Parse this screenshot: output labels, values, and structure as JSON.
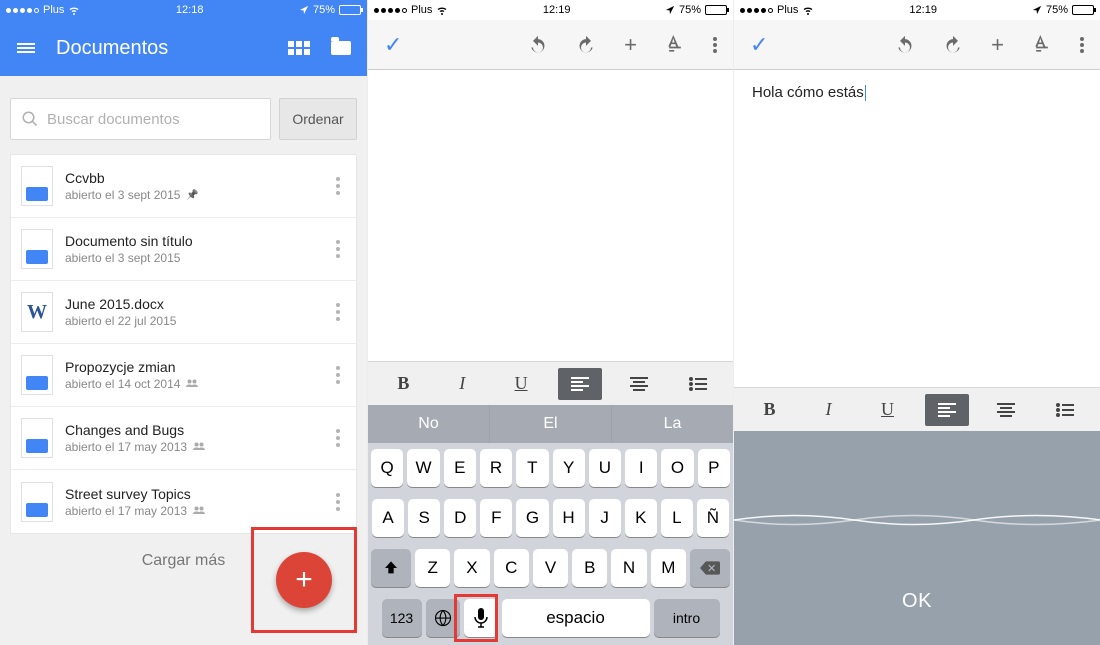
{
  "status": {
    "carrier": "Plus",
    "time1": "12:18",
    "time2": "12:19",
    "time3": "12:19",
    "battery_pct": "75%"
  },
  "screen1": {
    "title": "Documentos",
    "search_placeholder": "Buscar documentos",
    "sort_label": "Ordenar",
    "load_more": "Cargar más",
    "docs": [
      {
        "title": "Ccvbb",
        "subtitle": "abierto el 3 sept 2015",
        "pinned": true,
        "shared": false,
        "type": "gdoc"
      },
      {
        "title": "Documento sin título",
        "subtitle": "abierto el 3 sept 2015",
        "pinned": false,
        "shared": false,
        "type": "gdoc"
      },
      {
        "title": "June 2015.docx",
        "subtitle": "abierto el 22 jul 2015",
        "pinned": false,
        "shared": false,
        "type": "word"
      },
      {
        "title": "Propozycje zmian",
        "subtitle": "abierto el 14 oct 2014",
        "pinned": false,
        "shared": true,
        "type": "gdoc"
      },
      {
        "title": "Changes and Bugs",
        "subtitle": "abierto el 17 may 2013",
        "pinned": false,
        "shared": true,
        "type": "gdoc"
      },
      {
        "title": "Street survey Topics",
        "subtitle": "abierto el 17 may 2013",
        "pinned": false,
        "shared": true,
        "type": "gdoc"
      }
    ]
  },
  "screen3": {
    "doc_text": "Hola cómo estás",
    "ok_label": "OK"
  },
  "keyboard": {
    "suggestions": [
      "No",
      "El",
      "La"
    ],
    "row1": [
      "Q",
      "W",
      "E",
      "R",
      "T",
      "Y",
      "U",
      "I",
      "O",
      "P"
    ],
    "row2": [
      "A",
      "S",
      "D",
      "F",
      "G",
      "H",
      "J",
      "K",
      "L",
      "Ñ"
    ],
    "row3": [
      "Z",
      "X",
      "C",
      "V",
      "B",
      "N",
      "M"
    ],
    "numbers_key": "123",
    "space_key": "espacio",
    "return_key": "intro"
  },
  "format": {
    "bold": "B",
    "italic": "I",
    "underline": "U"
  }
}
